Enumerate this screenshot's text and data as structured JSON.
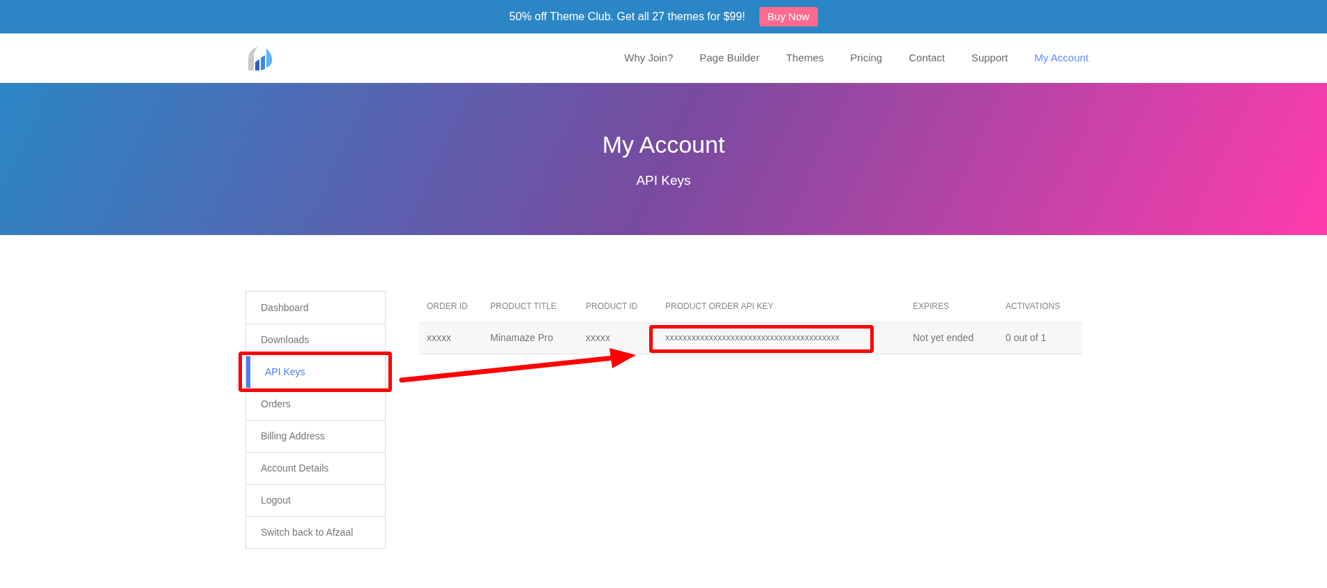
{
  "promo_bar": {
    "text": "50% off Theme Club. Get all 27 themes for $99!",
    "button": "Buy Now"
  },
  "nav": {
    "items": [
      {
        "label": "Why Join?",
        "selected": false
      },
      {
        "label": "Page Builder",
        "selected": false
      },
      {
        "label": "Themes",
        "selected": false
      },
      {
        "label": "Pricing",
        "selected": false
      },
      {
        "label": "Contact",
        "selected": false
      },
      {
        "label": "Support",
        "selected": false
      },
      {
        "label": "My Account",
        "selected": true
      }
    ]
  },
  "hero": {
    "title": "My Account",
    "subtitle": "API Keys"
  },
  "sidebar": {
    "items": [
      {
        "label": "Dashboard",
        "selected": false
      },
      {
        "label": "Downloads",
        "selected": false
      },
      {
        "label": "API Keys",
        "selected": true
      },
      {
        "label": "Orders",
        "selected": false
      },
      {
        "label": "Billing Address",
        "selected": false
      },
      {
        "label": "Account Details",
        "selected": false
      },
      {
        "label": "Logout",
        "selected": false
      },
      {
        "label": "Switch back to Afzaal",
        "selected": false
      }
    ]
  },
  "table": {
    "columns": [
      "ORDER ID",
      "PRODUCT TITLE",
      "PRODUCT ID",
      "PRODUCT ORDER API KEY",
      "EXPIRES",
      "ACTIVATIONS"
    ],
    "rows": [
      [
        "xxxxx",
        "Minamaze Pro",
        "xxxxx",
        "xxxxxxxxxxxxxxxxxxxxxxxxxxxxxxxxxxxxxxxx",
        "Not yet ended",
        "0 out of 1"
      ]
    ]
  }
}
